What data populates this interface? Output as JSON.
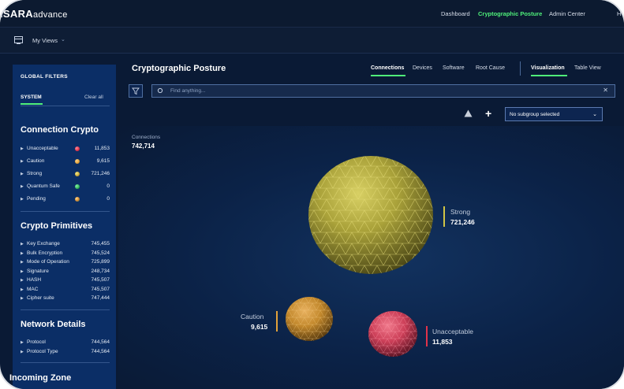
{
  "brand": {
    "name": "ISARA",
    "suffix": "advance"
  },
  "topnav": {
    "items": [
      "Dashboard",
      "Cryptographic Posture",
      "Admin Center",
      "H"
    ]
  },
  "subbar": {
    "my_views": "My Views"
  },
  "sidebar": {
    "title": "GLOBAL FILTERS",
    "system_label": "SYSTEM",
    "clear_all": "Clear all",
    "connection_crypto": {
      "title": "Connection Crypto",
      "items": [
        {
          "label": "Unacceptable",
          "value": "11,853",
          "color": "#e0334a"
        },
        {
          "label": "Caution",
          "value": "9,615",
          "color": "#e2a23a"
        },
        {
          "label": "Strong",
          "value": "721,246",
          "color": "#d1c445"
        },
        {
          "label": "Quantum Safe",
          "value": "0",
          "color": "#31b85a"
        },
        {
          "label": "Pending",
          "value": "0",
          "color": "#6a7fa0"
        }
      ]
    },
    "crypto_primitives": {
      "title": "Crypto Primitives",
      "items": [
        {
          "label": "Key Exchange",
          "value": "745,455"
        },
        {
          "label": "Bulk Encryption",
          "value": "745,524"
        },
        {
          "label": "Mode of Operation",
          "value": "725,899"
        },
        {
          "label": "Signature",
          "value": "248,734"
        },
        {
          "label": "HASH",
          "value": "745,507"
        },
        {
          "label": "MAC",
          "value": "745,507"
        },
        {
          "label": "Cipher suite",
          "value": "747,444"
        }
      ]
    },
    "network_details": {
      "title": "Network Details",
      "items": [
        {
          "label": "Protocol",
          "value": "744,564"
        },
        {
          "label": "Protocol Type",
          "value": "744,564"
        }
      ]
    },
    "incoming_zone": {
      "title": "Incoming Zone"
    }
  },
  "main": {
    "title": "Cryptographic Posture",
    "tabs": [
      "Connections",
      "Devices",
      "Software",
      "Root Cause"
    ],
    "view_tabs": [
      "Visualization",
      "Table View"
    ],
    "search_placeholder": "Find anything...",
    "subgroup_value": "No subgroup selected",
    "connections_label": "Connections",
    "connections_total": "742,714"
  },
  "bubbles": {
    "strong": {
      "label": "Strong",
      "value": "721,246",
      "color": "#d1c445"
    },
    "caution": {
      "label": "Caution",
      "value": "9,615",
      "color": "#e2a23a"
    },
    "unacceptable": {
      "label": "Unacceptable",
      "value": "11,853",
      "color": "#e0334a"
    }
  }
}
